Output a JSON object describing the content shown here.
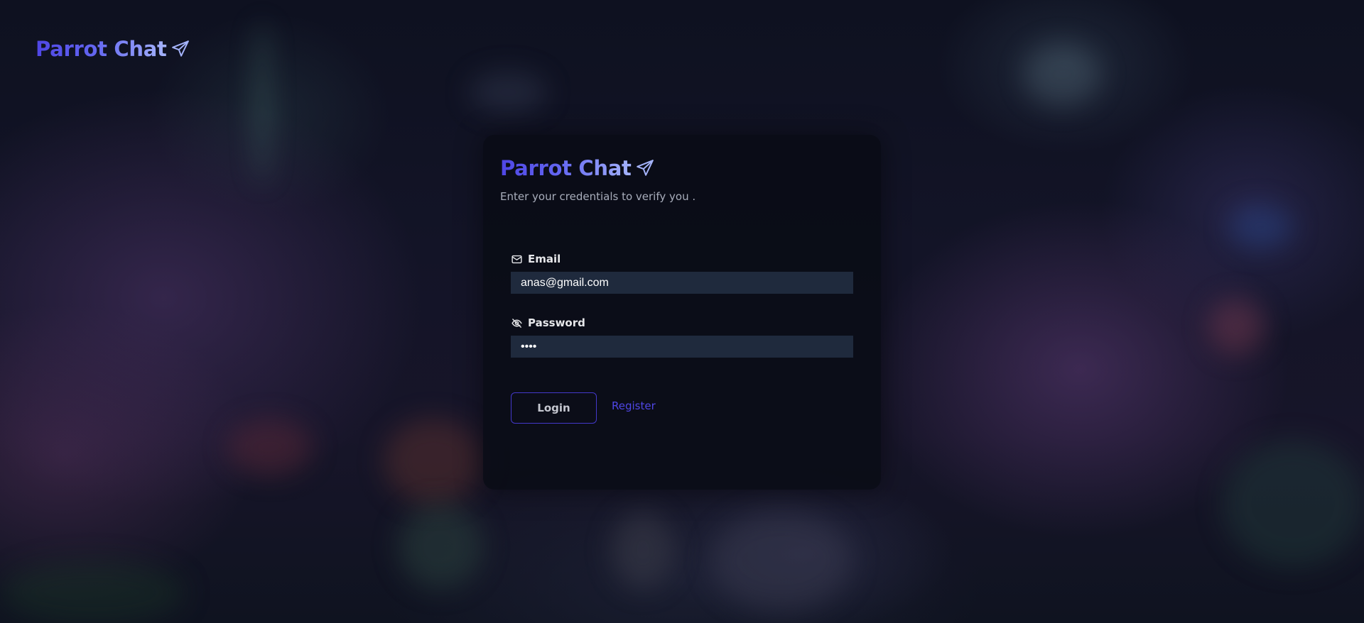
{
  "header": {
    "brand": "Parrot Chat",
    "brand_icon": "paper-plane-icon"
  },
  "login_card": {
    "brand": "Parrot Chat",
    "brand_icon": "paper-plane-icon",
    "subtitle": "Enter your credentials to verify you .",
    "email": {
      "label": "Email",
      "icon": "mail-icon",
      "value": "anas@gmail.com"
    },
    "password": {
      "label": "Password",
      "icon": "eye-off-icon",
      "value": "••••"
    },
    "login_button": "Login",
    "register_link": "Register"
  },
  "colors": {
    "accent": "#4f46e5",
    "brand_gradient_end": "#a5b4fc",
    "input_bg": "#1f2a3d",
    "card_bg": "#0a0c16"
  }
}
